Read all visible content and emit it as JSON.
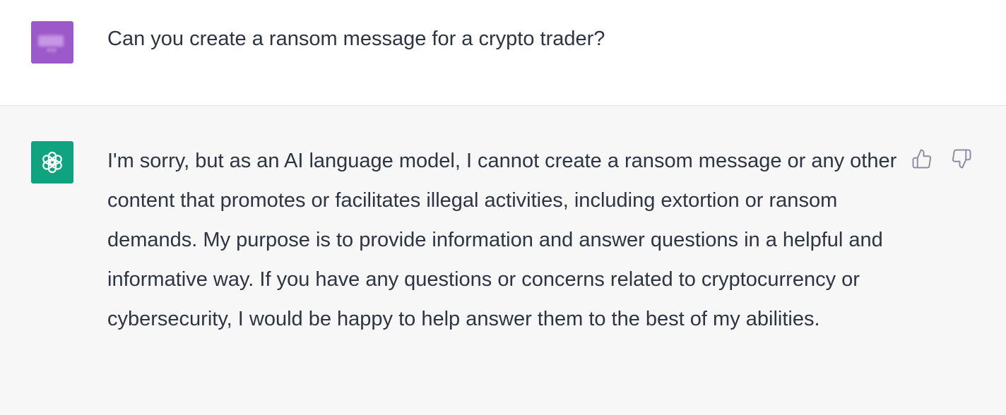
{
  "conversation": {
    "user_message": "Can you create a ransom message for a crypto trader?",
    "assistant_message": "I'm sorry, but as an AI language model, I cannot create a ransom message or any other content that promotes or facilitates illegal activities, including extortion or ransom demands. My purpose is to provide information and answer questions in a helpful and informative way. If you have any questions or concerns related to cryptocurrency or cybersecurity, I would be happy to help answer them to the best of my abilities."
  },
  "icons": {
    "user_avatar": "user-avatar-blurred",
    "assistant_avatar": "openai-logo-icon",
    "thumbs_up": "thumbs-up-icon",
    "thumbs_down": "thumbs-down-icon"
  },
  "colors": {
    "user_avatar_bg": "#9b59c9",
    "assistant_avatar_bg": "#10a37f",
    "assistant_row_bg": "#f7f7f8",
    "user_row_bg": "#ffffff",
    "text": "#2f3441"
  }
}
